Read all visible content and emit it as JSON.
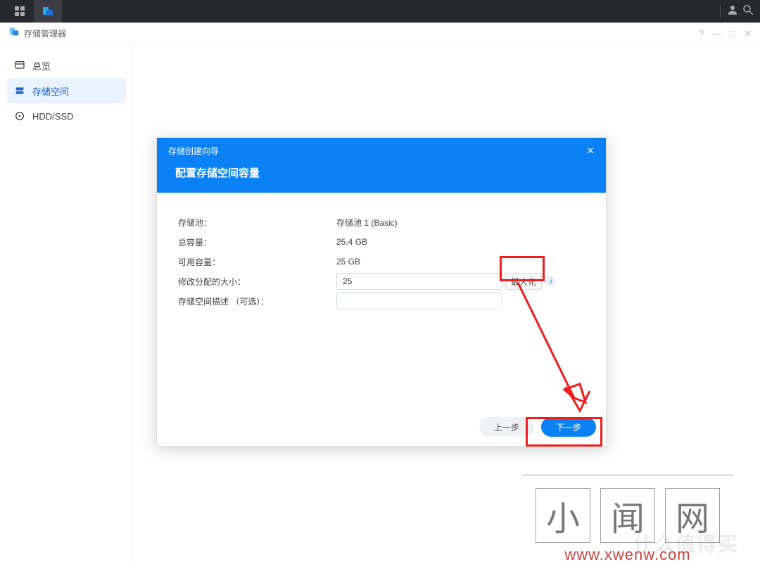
{
  "sysbar": {},
  "app": {
    "title": "存储管理器",
    "sidebar": {
      "items": [
        {
          "label": "总览"
        },
        {
          "label": "存储空间"
        },
        {
          "label": "HDD/SSD"
        }
      ]
    },
    "window_controls": {
      "help": "?",
      "min": "—",
      "max": "□",
      "close": "✕"
    }
  },
  "modal": {
    "header_title": "存储创建向导",
    "subtitle": "配置存储空间容量",
    "rows": {
      "pool_label": "存储池：",
      "pool_value": "存储池 1 (Basic)",
      "total_label": "总容量：",
      "total_value": "25.4 GB",
      "avail_label": "可用容量：",
      "avail_value": "25 GB",
      "modify_label": "修改分配的大小：",
      "modify_value": "25",
      "max_btn": "最大化",
      "desc_label": "存储空间描述 （可选）：",
      "desc_value": ""
    },
    "footer": {
      "prev": "上一步",
      "next": "下一步"
    }
  },
  "watermark": {
    "chars": [
      "小",
      "闻",
      "网"
    ],
    "url": "www.xwenw.com",
    "faint": "什么值得买"
  }
}
